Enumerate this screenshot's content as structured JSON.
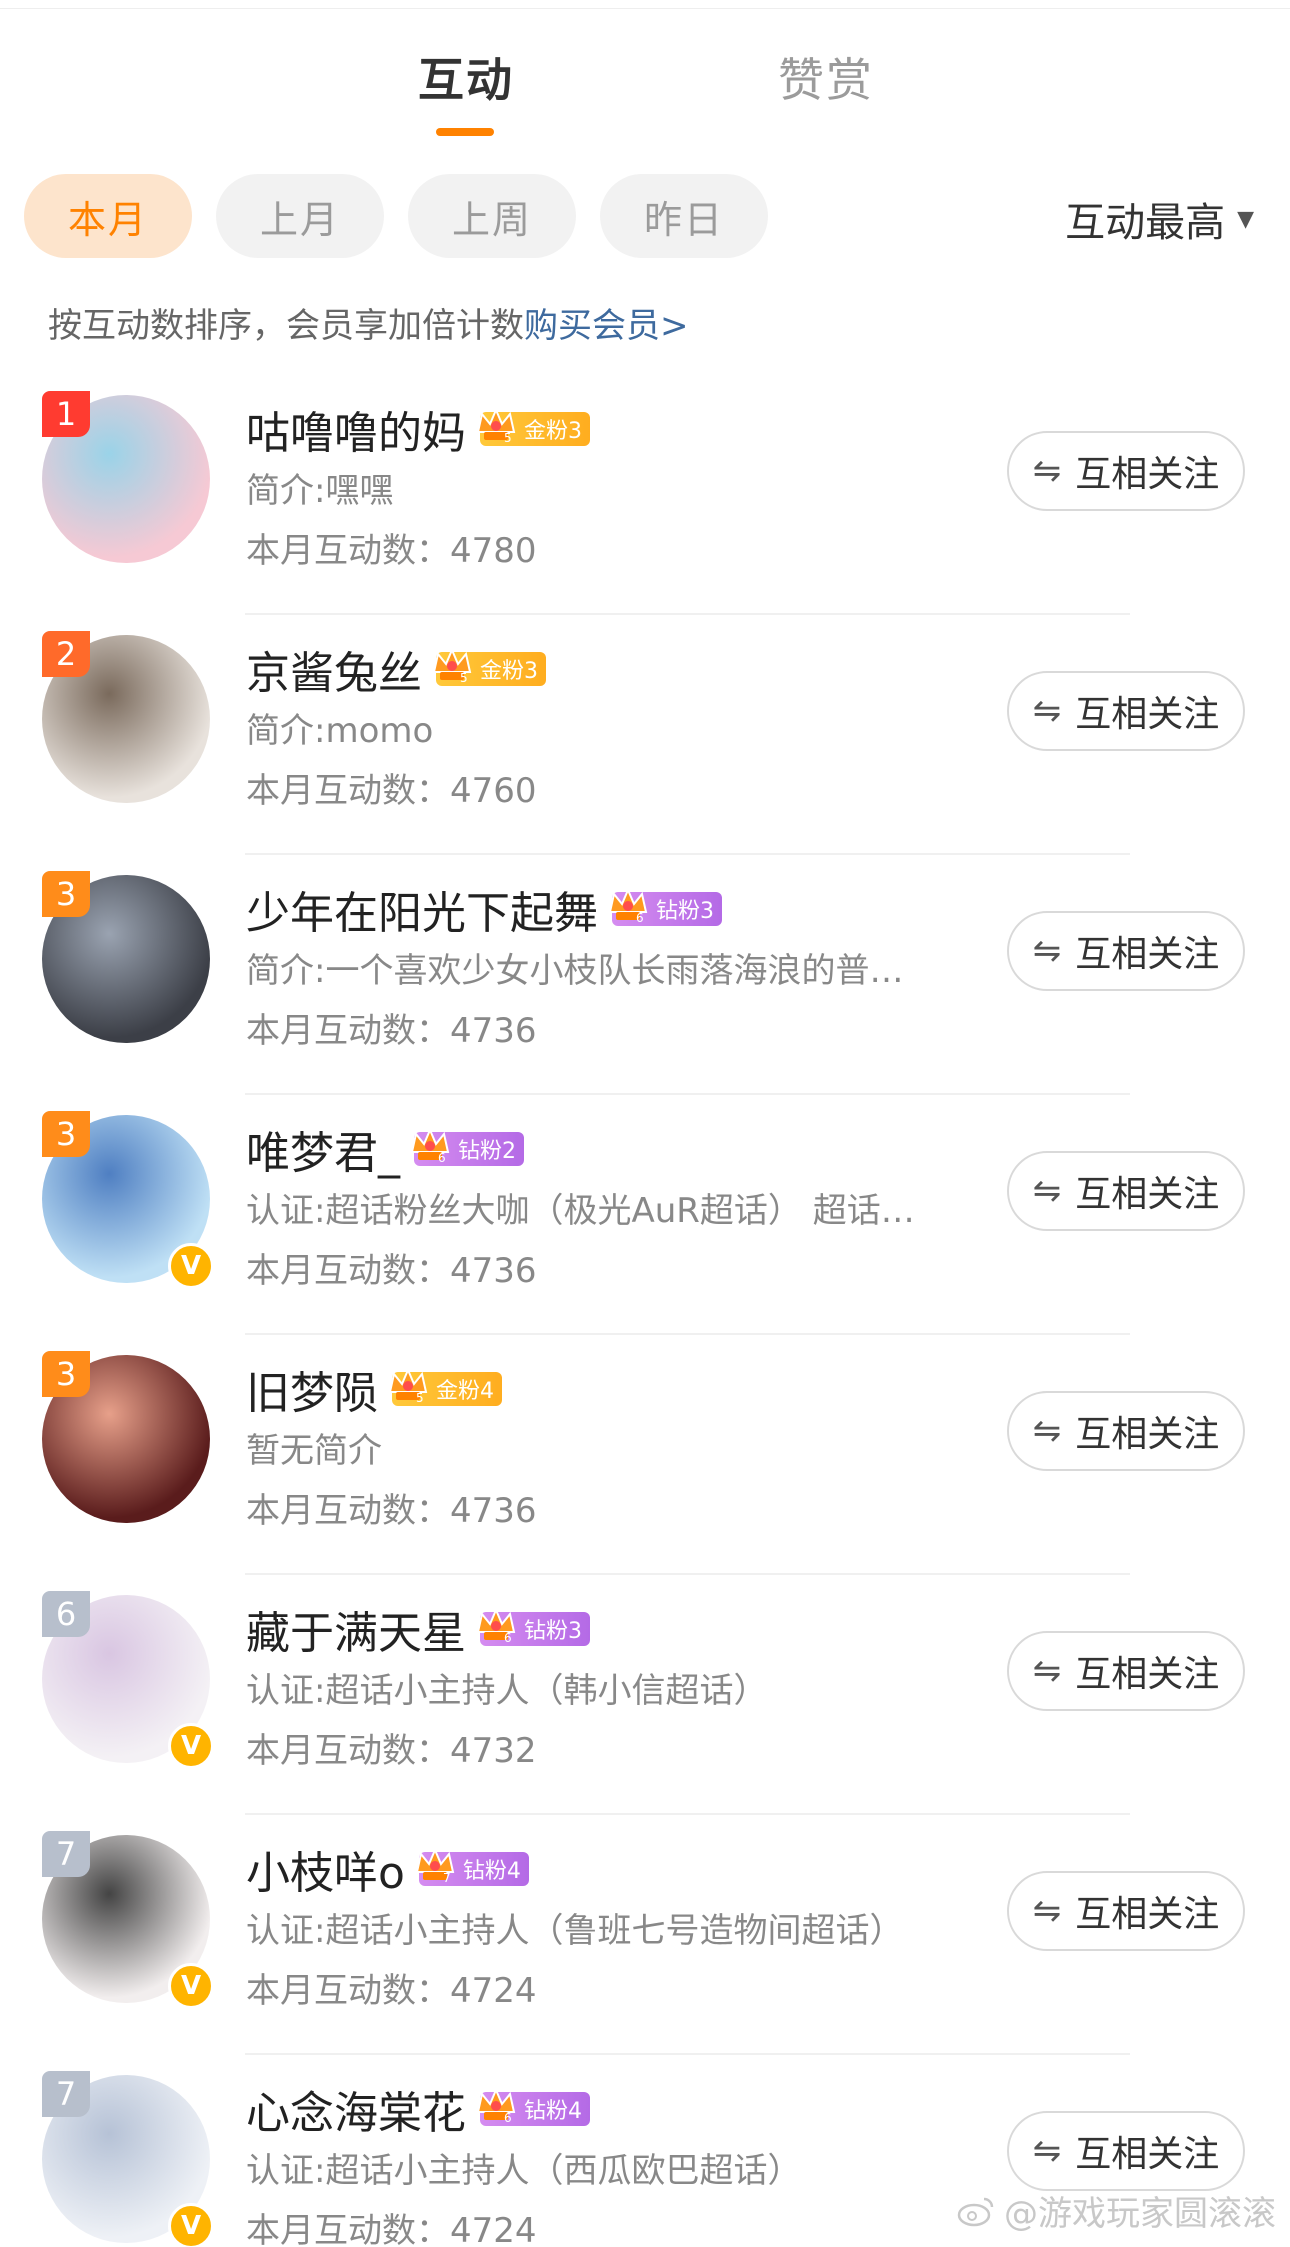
{
  "tabs": [
    {
      "label": "互动"
    },
    {
      "label": "赞赏"
    }
  ],
  "filters": [
    {
      "label": "本月"
    },
    {
      "label": "上月"
    },
    {
      "label": "上周"
    },
    {
      "label": "昨日"
    }
  ],
  "sort": {
    "label": "互动最高",
    "caret": "▼"
  },
  "hint": {
    "text": "按互动数排序，会员享加倍计数",
    "link": "购买会员>"
  },
  "follow_label": "互相关注",
  "users": [
    {
      "rank": "1",
      "name": "咕噜噜的妈",
      "badge": "金粉3",
      "badge_level": "5",
      "desc": "简介:嘿嘿",
      "count": "本月互动数：4780",
      "verified": false
    },
    {
      "rank": "2",
      "name": "京酱兔丝",
      "badge": "金粉3",
      "badge_level": "5",
      "desc": "简介:momo",
      "count": "本月互动数：4760",
      "verified": false
    },
    {
      "rank": "3",
      "name": "少年在阳光下起舞",
      "badge": "钻粉3",
      "badge_level": "6",
      "desc": "简介:一个喜欢少女小枝队长雨落海浪的普…",
      "count": "本月互动数：4736",
      "verified": false
    },
    {
      "rank": "3",
      "name": "唯梦君_",
      "badge": "钻粉2",
      "badge_level": "6",
      "desc": "认证:超话粉丝大咖（极光AuR超话） 超话…",
      "count": "本月互动数：4736",
      "verified": true
    },
    {
      "rank": "3",
      "name": "旧梦陨",
      "badge": "金粉4",
      "badge_level": "5",
      "desc": "暂无简介",
      "count": "本月互动数：4736",
      "verified": false
    },
    {
      "rank": "6",
      "name": "藏于满天星",
      "badge": "钻粉3",
      "badge_level": "6",
      "desc": "认证:超话小主持人（韩小信超话）",
      "count": "本月互动数：4732",
      "verified": true
    },
    {
      "rank": "7",
      "name": "小枝咩o",
      "badge": "钻粉4",
      "badge_level": "7",
      "desc": "认证:超话小主持人（鲁班七号造物间超话）",
      "count": "本月互动数：4724",
      "verified": true
    },
    {
      "rank": "7",
      "name": "心念海棠花",
      "badge": "钻粉4",
      "badge_level": "6",
      "desc": "认证:超话小主持人（西瓜欧巴超话）",
      "count": "本月互动数：4724",
      "verified": true
    }
  ],
  "watermark": "@游戏玩家圆滚滚",
  "colors": {
    "accent": "#ff8200",
    "link": "#3e6a9e",
    "gold_badge": "#ffb92a",
    "diamond_badge": "#c27be9",
    "verified": "#ffb400"
  },
  "icons": {
    "follow": "mutual-follow-icon",
    "crown": "crown-icon",
    "verified": "verified-v-icon",
    "caret": "caret-down-icon"
  }
}
